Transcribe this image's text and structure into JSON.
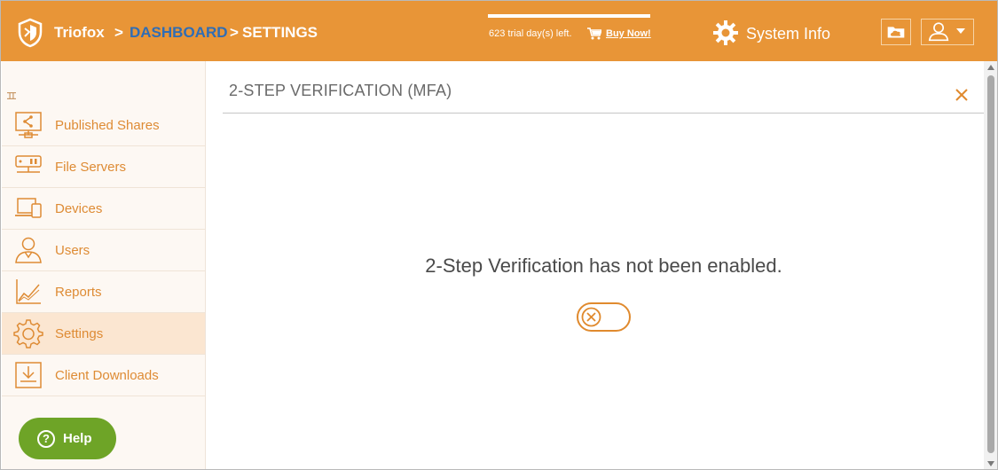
{
  "header": {
    "brand": "Triofox",
    "breadcrumb_sep": ">",
    "breadcrumb_dashboard": "DASHBOARD",
    "breadcrumb_settings": "SETTINGS",
    "trial_text": "623 trial day(s) left.",
    "buy_now": "Buy Now!",
    "system_info": "System Info",
    "icons": [
      "shield-logo-icon",
      "cart-icon",
      "gear-icon",
      "cloud-folder-icon",
      "user-icon",
      "caret-down-icon"
    ]
  },
  "sidebar": {
    "items": [
      {
        "label": "Published Shares",
        "icon": "share-monitor-icon"
      },
      {
        "label": "File Servers",
        "icon": "server-icon"
      },
      {
        "label": "Devices",
        "icon": "devices-icon"
      },
      {
        "label": "Users",
        "icon": "user-icon"
      },
      {
        "label": "Reports",
        "icon": "chart-icon"
      },
      {
        "label": "Settings",
        "icon": "gear-icon",
        "active": true
      },
      {
        "label": "Client Downloads",
        "icon": "download-icon"
      }
    ],
    "help_label": "Help",
    "help_glyph": "?"
  },
  "main": {
    "title": "2-STEP VERIFICATION (MFA)",
    "status_text": "2-Step Verification has not been enabled.",
    "toggle_enabled": false
  },
  "colors": {
    "accent": "#e89537",
    "link_blue": "#2f6db5",
    "nav_text": "#de8b34",
    "help_green": "#6ea427"
  }
}
